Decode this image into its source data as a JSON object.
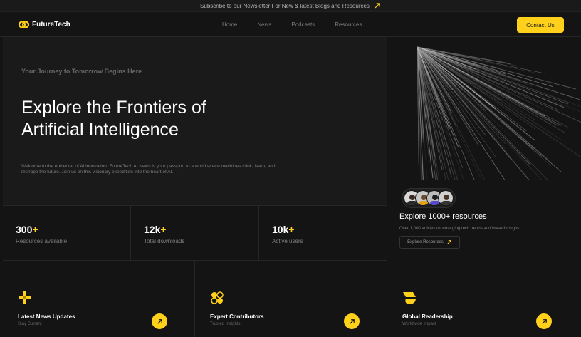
{
  "banner": {
    "text": "Subscribe to our Newsletter For New & latest Blogs and Resources",
    "icon": "arrow-up-right-icon"
  },
  "brand": {
    "name": "FutureTech",
    "accent": "#ffd11a"
  },
  "nav": {
    "items": [
      "Home",
      "News",
      "Podcasts",
      "Resources"
    ],
    "cta": "Contact Us"
  },
  "hero": {
    "eyebrow": "Your Journey to Tomorrow Begins Here",
    "title_line1": "Explore the Frontiers of",
    "title_line2": "Artificial Intelligence",
    "description": "Welcome to the epicenter of AI innovation. FutureTech AI News is your passport to a world where machines think, learn, and reshape the future. Join us on this visionary expedition into the heart of AI."
  },
  "stats": [
    {
      "value": "300",
      "suffix": "+",
      "label": "Resources available"
    },
    {
      "value": "12k",
      "suffix": "+",
      "label": "Total downloads"
    },
    {
      "value": "10k",
      "suffix": "+",
      "label": "Active users"
    }
  ],
  "side": {
    "title": "Explore 1000+ resources",
    "description": "Over 1,000 articles on emerging tech trends and breakthroughs.",
    "button": "Explore Resources"
  },
  "features": [
    {
      "title": "Latest News Updates",
      "subtitle": "Stay Current",
      "icon": "plus-sparkle-icon"
    },
    {
      "title": "Expert Contributors",
      "subtitle": "Trusted Insights",
      "icon": "circles-icon"
    },
    {
      "title": "Global Readership",
      "subtitle": "Worldwide Impact",
      "icon": "globe-shape-icon"
    }
  ]
}
